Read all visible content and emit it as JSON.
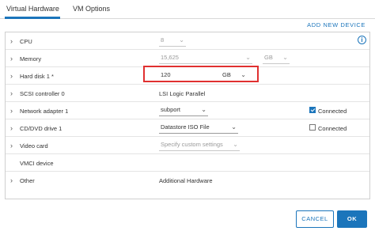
{
  "tabs": [
    "Virtual Hardware",
    "VM Options"
  ],
  "add_new_device": "ADD NEW DEVICE",
  "rows": [
    {
      "label": "CPU",
      "expandable": true,
      "value": "8",
      "disabled": true
    },
    {
      "label": "Memory",
      "expandable": true,
      "value": "15,625",
      "unit": "GB",
      "disabled": true
    },
    {
      "label": "Hard disk 1 *",
      "expandable": true,
      "value": "120",
      "unit": "GB"
    },
    {
      "label": "SCSI controller 0",
      "expandable": true,
      "value": "LSI Logic Parallel"
    },
    {
      "label": "Network adapter 1",
      "expandable": true,
      "value": "subport",
      "checkbox_label": "Connected",
      "checked": true
    },
    {
      "label": "CD/DVD drive 1",
      "expandable": true,
      "value": "Datastore ISO File",
      "checkbox_label": "Connected",
      "checked": false
    },
    {
      "label": "Video card",
      "expandable": true,
      "value": "Specify custom settings",
      "disabled": true
    },
    {
      "label": "VMCI device",
      "expandable": false
    },
    {
      "label": "Other",
      "expandable": true,
      "value": "Additional Hardware"
    }
  ],
  "info_icon": "i",
  "chevron": "›",
  "caret": "⌄",
  "buttons": {
    "cancel": "CANCEL",
    "ok": "OK"
  },
  "colors": {
    "accent": "#1b75bb",
    "highlight": "#e03030"
  }
}
